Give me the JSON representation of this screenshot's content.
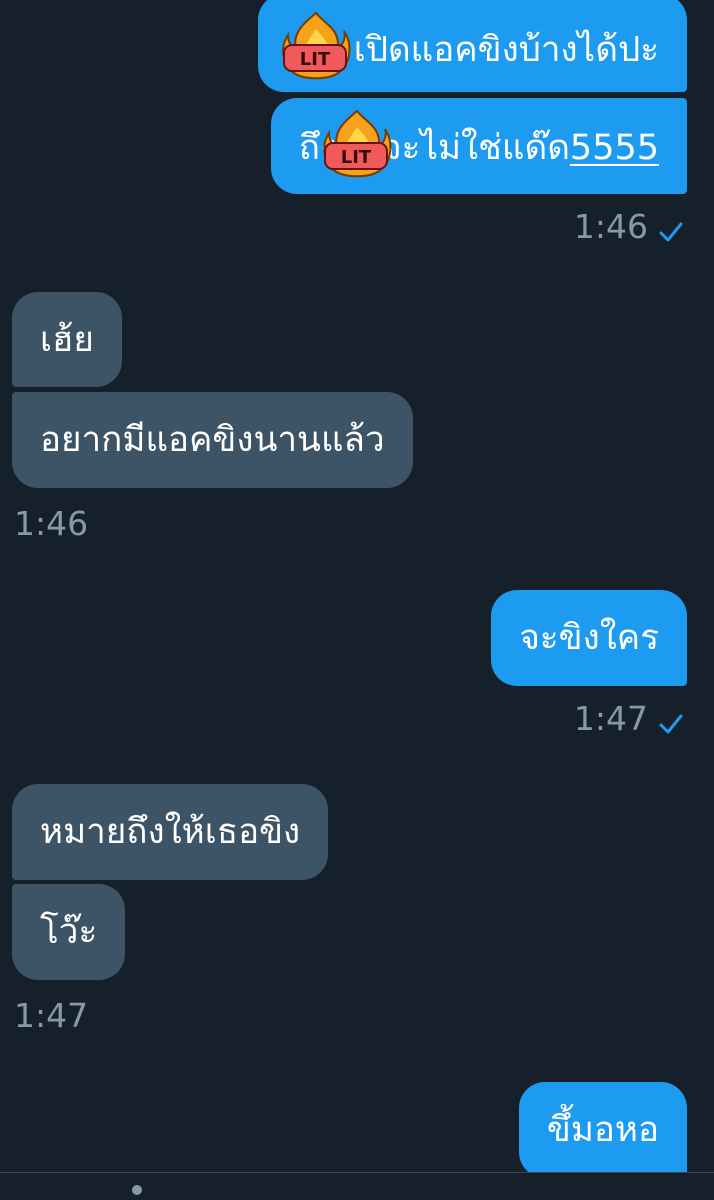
{
  "conversation": {
    "messages": [
      {
        "text_after": "เปิดแอคขิงบ้างได้ปะ",
        "sticker": "LIT",
        "direction": "outgoing"
      },
      {
        "text_before": "ถึง",
        "sticker": "LIT",
        "text_after": "จะไม่ใช่แด๊ด",
        "link_text": "5555",
        "direction": "outgoing"
      },
      {
        "time": "1:46",
        "status": "read-check"
      },
      {
        "text": "เฮ้ย",
        "direction": "incoming"
      },
      {
        "text": "อยากมีแอคขิงนานแล้ว",
        "direction": "incoming"
      },
      {
        "time": "1:46"
      },
      {
        "text": "จะขิงใคร",
        "direction": "outgoing"
      },
      {
        "time": "1:47",
        "status": "read-check"
      },
      {
        "text": "หมายถึงให้เธอขิง",
        "direction": "incoming"
      },
      {
        "text": "โว๊ะ",
        "direction": "incoming"
      },
      {
        "time": "1:47"
      },
      {
        "text": "ขึ้มอหอ",
        "direction": "outgoing"
      }
    ]
  },
  "colors": {
    "background": "#15202b",
    "outgoing_bubble": "#1d9bf0",
    "incoming_bubble": "#3d5466",
    "timestamp": "#8899a6",
    "check": "#1d9bf0"
  },
  "icons": {
    "sticker": "lit-fire-sticker-icon",
    "read_status": "checkmark-icon"
  }
}
